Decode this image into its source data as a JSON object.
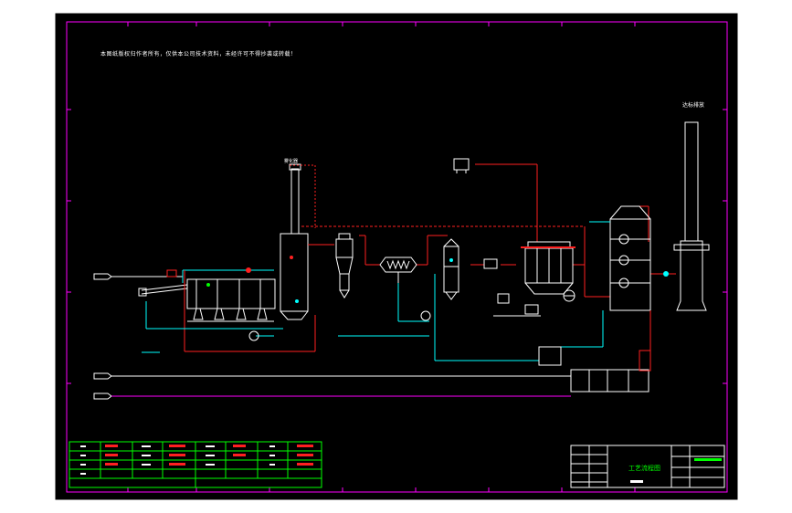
{
  "drawing": {
    "note": "本图纸版权归作者所有，仅供本公司技术资料，未经许可不得抄袭或转载！",
    "stack_label": "达标排放",
    "tower_label": "雾化器",
    "title_block_title": "工艺流程图"
  },
  "colors": {
    "sheet": "#000000",
    "frame": "#ff00ff",
    "process_line": "#ffffff",
    "flue_gas_line": "#ff2020",
    "water_line": "#00ffff",
    "equipment": "#ffffff",
    "accent": "#00ff00"
  }
}
